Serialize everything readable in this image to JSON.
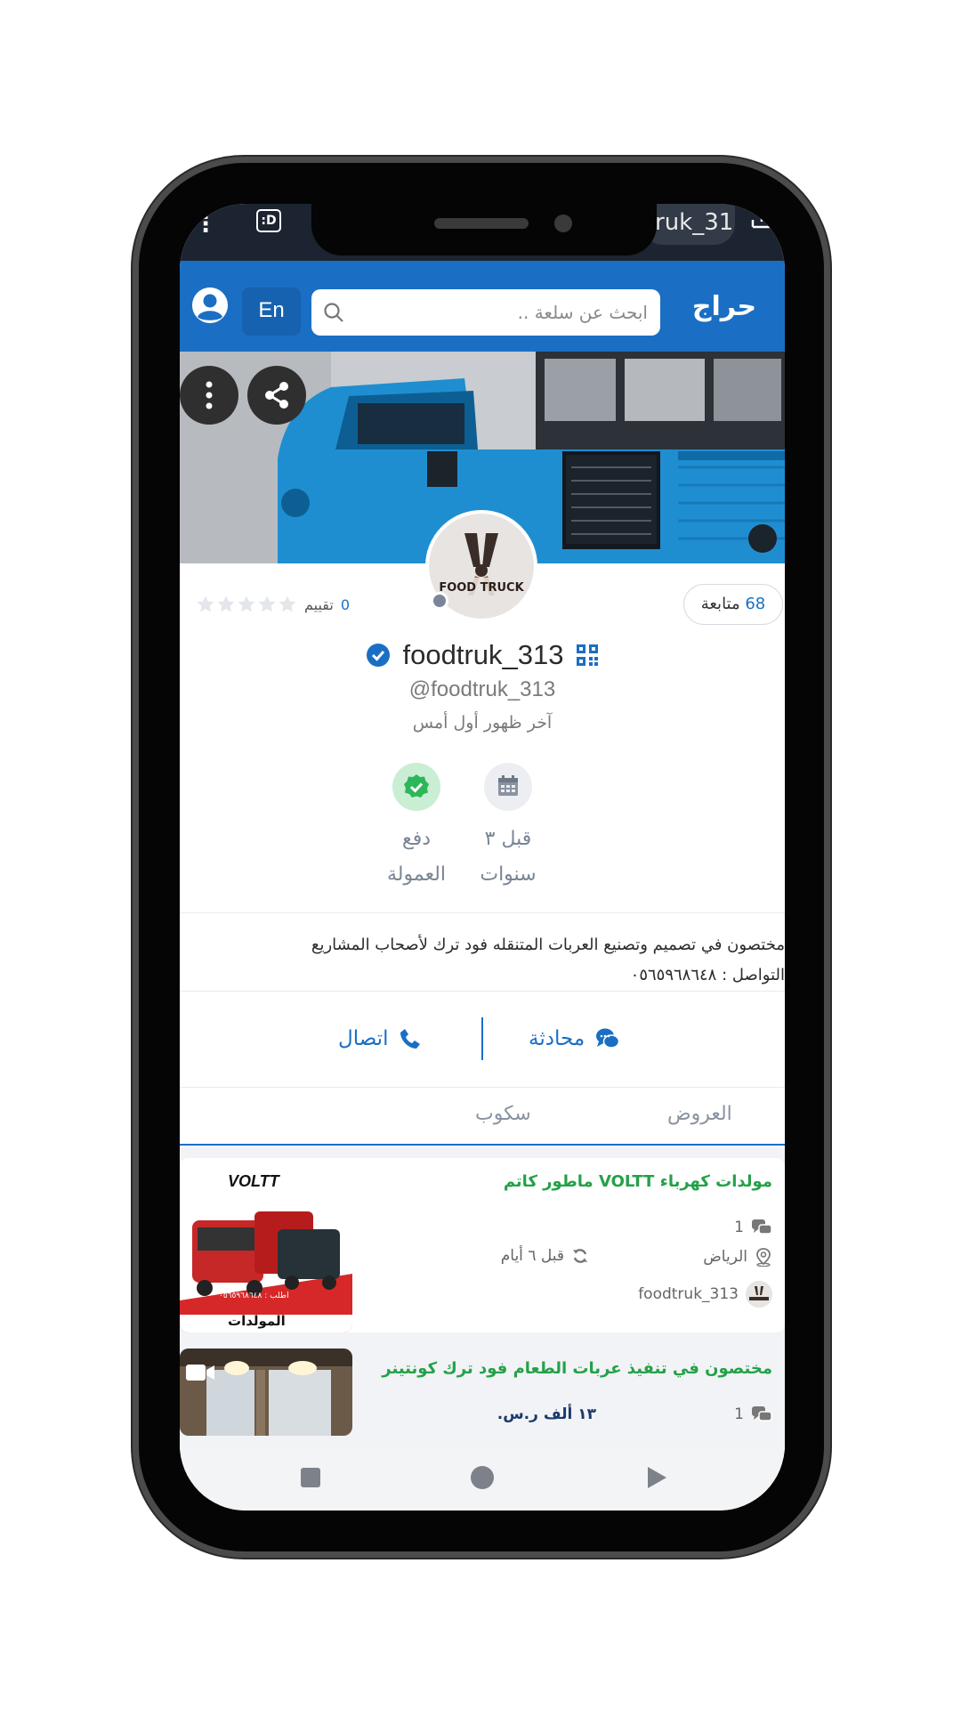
{
  "status_bar": {
    "dots": "⋮",
    "d_icon": ":D",
    "pill_text": "ruk_31"
  },
  "header": {
    "logo_text": "حراج",
    "search_placeholder": "ابحث عن سلعة ..",
    "lang_button": "En"
  },
  "profile": {
    "username": "foodtruk_313",
    "handle": "@foodtruk_313",
    "last_seen": "آخر ظهور أول أمس",
    "followers_count": "68",
    "followers_label": "متابعة",
    "rating_count": "0",
    "rating_label": "تقييم",
    "rating_stars": 0,
    "avatar_text": "FOOD TRUCK",
    "badges": [
      {
        "icon": "calendar-icon",
        "line1": "قبل ٣",
        "line2": "سنوات"
      },
      {
        "icon": "check-badge-icon",
        "line1": "دفع",
        "line2": "العمولة"
      }
    ],
    "bio_line1": "مختصون في تصميم وتصنيع العربات المتنقله فود ترك لأصحاب المشاريع",
    "bio_line2": "التواصل : ٠٥٦٥٩٦٨٦٤٨"
  },
  "actions": {
    "chat": "محادثة",
    "call": "اتصال"
  },
  "tabs": [
    "العروض",
    "سكوب"
  ],
  "listings": [
    {
      "title": "مولدات كهرباء VOLTT ماطور كاتم",
      "comments": "1",
      "city": "الرياض",
      "time": "قبل ٦ أيام",
      "seller": "foodtruk_313",
      "thumb_brand": "VOLTT",
      "thumb_phone": "اطلب : ٠٥٦٥٩٦٨٦٤٨",
      "thumb_caption": "المولدات"
    },
    {
      "title": "مختصون في تنفيذ عربات الطعام فود ترك كونتينر",
      "comments": "1",
      "price": "١٣ ألف ر.س."
    }
  ],
  "colors": {
    "brand_blue": "#1a6fc4",
    "title_green": "#24a148",
    "status_dark": "#1b2430"
  }
}
